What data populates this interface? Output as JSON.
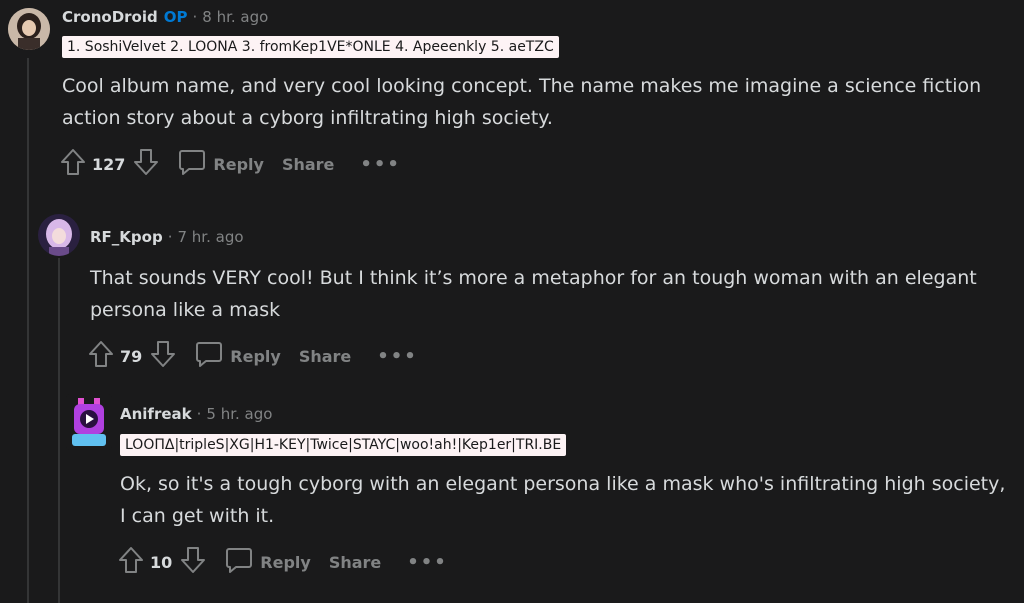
{
  "comments": [
    {
      "author": "CronoDroid",
      "op_badge": "OP",
      "time": "8 hr. ago",
      "flair": "1. SoshiVelvet 2. LOONA 3. fromKep1VE*ONLE 4. Apeeenkly 5. aeTZC",
      "body": "Cool album name, and very cool looking concept. The name makes me imagine a science fiction action story about a cyborg infiltrating high society.",
      "score": "127",
      "reply_label": "Reply",
      "share_label": "Share",
      "more_label": "•••"
    },
    {
      "author": "RF_Kpop",
      "time": "7 hr. ago",
      "body": "That sounds VERY cool! But I think it’s more a metaphor for an tough woman with an elegant persona like a mask",
      "score": "79",
      "reply_label": "Reply",
      "share_label": "Share",
      "more_label": "•••"
    },
    {
      "author": "Anifreak",
      "time": "5 hr. ago",
      "flair": "LOOΠΔ|tripleS|XG|H1-KEY|Twice|STAYC|woo!ah!|Kep1er|TRI.BE",
      "body": "Ok, so it's a tough cyborg with an elegant persona like a mask who's infiltrating high society, I can get with it.",
      "score": "10",
      "reply_label": "Reply",
      "share_label": "Share",
      "more_label": "•••"
    }
  ],
  "colors": {
    "background": "#1a1a1b",
    "text": "#d7dadc",
    "muted": "#818384",
    "op": "#0079d3",
    "flair_bg": "#fdf3f5"
  },
  "icons": [
    "upvote-icon",
    "downvote-icon",
    "comment-bubble-icon"
  ]
}
